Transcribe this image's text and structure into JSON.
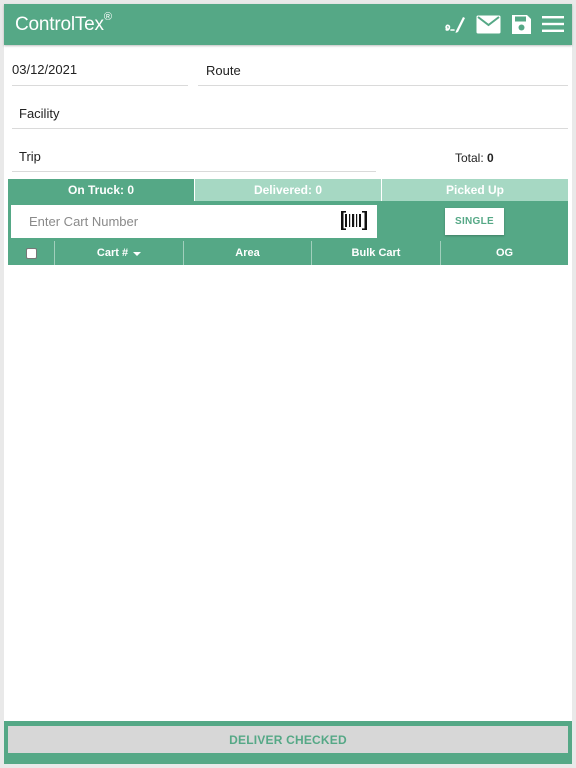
{
  "app": {
    "brand": "ControlTex",
    "brand_mark": "®",
    "header_icons": [
      "signature-icon",
      "mail-icon",
      "save-icon",
      "menu-icon"
    ]
  },
  "form": {
    "date": "03/12/2021",
    "route_label": "Route",
    "facility_label": "Facility",
    "trip_label": "Trip",
    "total_label": "Total:",
    "total_value": "0"
  },
  "tabs": [
    {
      "label": "On Truck: 0",
      "active": true
    },
    {
      "label": "Delivered: 0",
      "active": false
    },
    {
      "label": "Picked Up",
      "active": false
    }
  ],
  "scan": {
    "placeholder": "Enter Cart Number",
    "single_label": "SINGLE"
  },
  "table": {
    "columns": [
      "Cart #",
      "Area",
      "Bulk Cart",
      "OG"
    ],
    "rows": []
  },
  "footer": {
    "deliver_label": "DELIVER CHECKED"
  },
  "colors": {
    "primary": "#55a886",
    "tab_inactive": "#a6d8c3",
    "footer_button": "#d7d7d7"
  }
}
